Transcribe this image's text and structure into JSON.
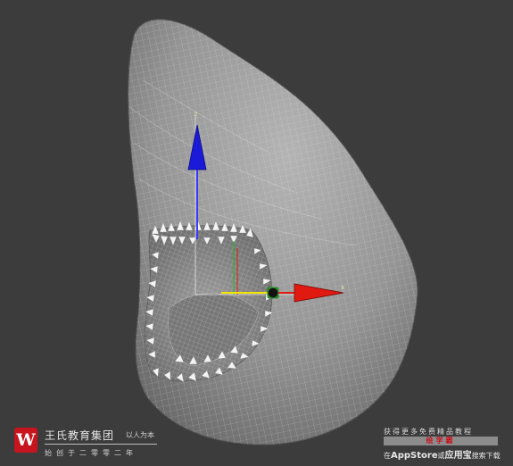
{
  "viewport": {
    "object": "shark-head-mesh",
    "axis_labels": {
      "x": "x",
      "z": "z"
    },
    "colors": {
      "background": "#3c3c3c",
      "x_axis": "#e01a10",
      "y_axis": "#1fb81f",
      "z_axis": "#1a1ad8",
      "mesh": "#9b9b9b",
      "teeth": "#f4f4f4"
    }
  },
  "watermark": {
    "logo_letter": "W",
    "name": "王氏教育集团",
    "slogan": "以人为本",
    "motto": "始创于二零零二年",
    "promo_top": "获得更多免费精品教程",
    "promo_badge": "绘学霸",
    "promo_prefix": "在",
    "promo_store": "AppStore",
    "promo_or": "或",
    "promo_app": "应用宝",
    "promo_suffix": "搜索下载"
  }
}
